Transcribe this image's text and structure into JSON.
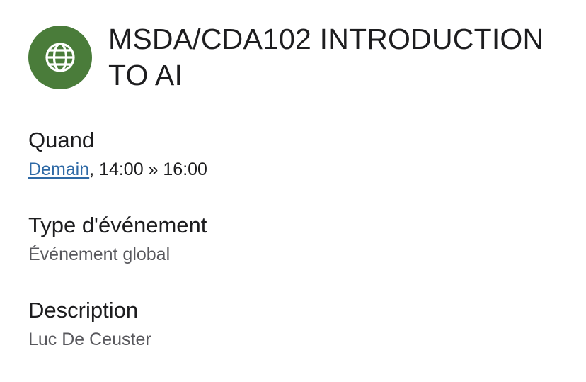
{
  "event": {
    "icon": "globe-icon",
    "icon_bg_color": "#4a7c3a",
    "title": "MSDA/CDA102 INTRODUCTION TO AI"
  },
  "when": {
    "label": "Quand",
    "date_link": "Demain",
    "time_range": ", 14:00 » 16:00"
  },
  "event_type": {
    "label": "Type d'événement",
    "value": "Événement global"
  },
  "description": {
    "label": "Description",
    "value": "Luc De Ceuster"
  },
  "colors": {
    "link": "#2f6aa6",
    "secondary_text": "#58585d",
    "divider": "#d9d9de"
  }
}
